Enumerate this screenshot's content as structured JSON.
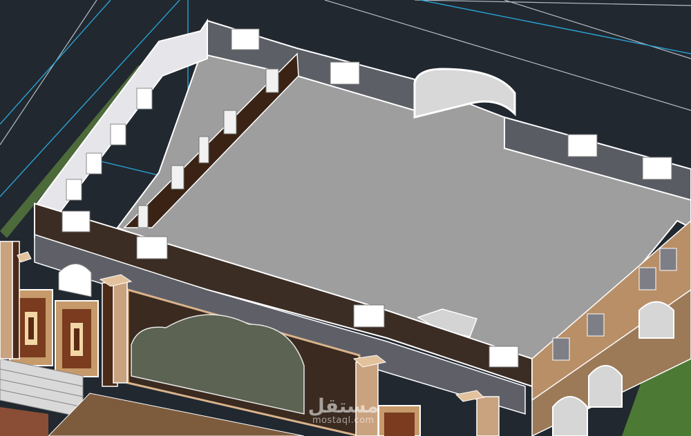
{
  "viewport": {
    "background": "#212830",
    "accent_line_color": "#2aa3d6",
    "roof_color": "#9e9e9e",
    "parapet_color": "#ffffff",
    "wall_dark_color": "#3d2f24",
    "wall_tan_color": "#9c7a58",
    "stone_color": "#c9a27f"
  },
  "watermark": {
    "arabic": "مستقل",
    "latin": "mostaql.com"
  }
}
